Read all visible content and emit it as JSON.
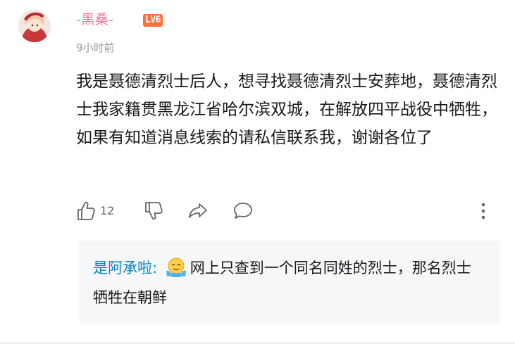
{
  "comment": {
    "username": "-黑桑-",
    "level": "LV6",
    "time": "9小时前",
    "content": "我是聂德清烈士后人，想寻找聂德清烈士安葬地，聂德清烈士我家籍贯黑龙江省哈尔滨双城，在解放四平战役中牺牲，如果有知道消息线索的请私信联系我，谢谢各位了",
    "like_count": "12"
  },
  "reply": {
    "username": "是阿承啦",
    "separator": ":",
    "emoji": "hug-emoji",
    "text": "网上只查到一个同名同姓的烈士，那名烈士牺牲在朝鲜"
  },
  "colors": {
    "username": "#fb7299",
    "level_badge": "#ff6f3c",
    "reply_username": "#0884c9",
    "reply_bg": "#f6f7f8",
    "muted": "#9499a0"
  },
  "icons": [
    "avatar",
    "thumb-up-icon",
    "thumb-down-icon",
    "share-icon",
    "reply-icon",
    "more-icon",
    "hug-emoji-icon"
  ]
}
